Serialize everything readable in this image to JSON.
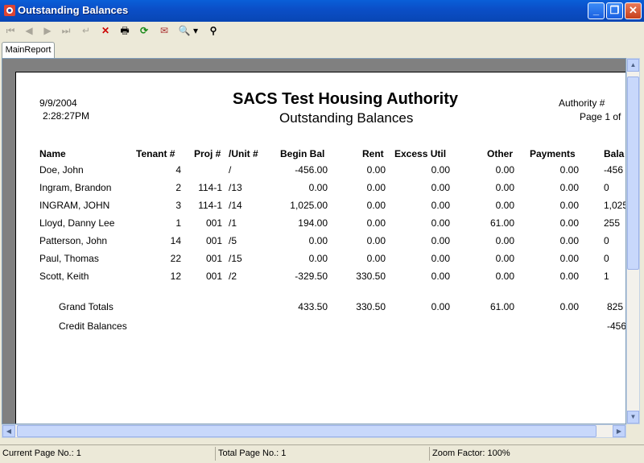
{
  "window": {
    "title": "Outstanding Balances"
  },
  "toolbar": {
    "first_page": "⏮",
    "prev_page": "◀",
    "next_page": "▶",
    "last_page": "⏭",
    "goto": "↵",
    "stop": "✕",
    "print": "🖶",
    "refresh": "⟳",
    "export": "✉",
    "zoom": "🔍",
    "zoom_menu": "▾",
    "find": "⚲"
  },
  "tabs": [
    {
      "label": "MainReport"
    }
  ],
  "report": {
    "date": "9/9/2004",
    "time": "2:28:27PM",
    "title": "SACS Test Housing Authority",
    "subtitle": "Outstanding Balances",
    "authority_label": "Authority #",
    "page_label": "Page 1 of",
    "columns": {
      "name": "Name",
      "tenant": "Tenant #",
      "proj": "Proj #",
      "unit": "/Unit #",
      "begin_bal": "Begin Bal",
      "rent": "Rent",
      "excess_util": "Excess Util",
      "other": "Other",
      "payments": "Payments",
      "balance": "Bala"
    },
    "rows": [
      {
        "name": "Doe, John",
        "tenant": "4",
        "proj": "",
        "unit": "/",
        "begin_bal": "-456.00",
        "rent": "0.00",
        "excess_util": "0.00",
        "other": "0.00",
        "payments": "0.00",
        "balance": "-456"
      },
      {
        "name": "Ingram, Brandon",
        "tenant": "2",
        "proj": "114-1",
        "unit": "/13",
        "begin_bal": "0.00",
        "rent": "0.00",
        "excess_util": "0.00",
        "other": "0.00",
        "payments": "0.00",
        "balance": "0"
      },
      {
        "name": "INGRAM, JOHN",
        "tenant": "3",
        "proj": "114-1",
        "unit": "/14",
        "begin_bal": "1,025.00",
        "rent": "0.00",
        "excess_util": "0.00",
        "other": "0.00",
        "payments": "0.00",
        "balance": "1,025"
      },
      {
        "name": "Lloyd, Danny Lee",
        "tenant": "1",
        "proj": "001",
        "unit": "/1",
        "begin_bal": "194.00",
        "rent": "0.00",
        "excess_util": "0.00",
        "other": "61.00",
        "payments": "0.00",
        "balance": "255"
      },
      {
        "name": "Patterson, John",
        "tenant": "14",
        "proj": "001",
        "unit": "/5",
        "begin_bal": "0.00",
        "rent": "0.00",
        "excess_util": "0.00",
        "other": "0.00",
        "payments": "0.00",
        "balance": "0"
      },
      {
        "name": "Paul, Thomas",
        "tenant": "22",
        "proj": "001",
        "unit": "/15",
        "begin_bal": "0.00",
        "rent": "0.00",
        "excess_util": "0.00",
        "other": "0.00",
        "payments": "0.00",
        "balance": "0"
      },
      {
        "name": "Scott, Keith",
        "tenant": "12",
        "proj": "001",
        "unit": "/2",
        "begin_bal": "-329.50",
        "rent": "330.50",
        "excess_util": "0.00",
        "other": "0.00",
        "payments": "0.00",
        "balance": "1"
      }
    ],
    "grand_totals": {
      "label": "Grand Totals",
      "begin_bal": "433.50",
      "rent": "330.50",
      "excess_util": "0.00",
      "other": "61.00",
      "payments": "0.00",
      "balance": "825"
    },
    "credit_balances": {
      "label": "Credit Balances",
      "balance": "-456"
    }
  },
  "status": {
    "current_page": "Current Page No.: 1",
    "total_page": "Total Page No.: 1",
    "zoom": "Zoom Factor: 100%"
  },
  "colors": {
    "titlebar": "#0a5fd8",
    "close": "#c6401b",
    "chrome": "#ece9d8",
    "viewport_bg": "#808080"
  }
}
